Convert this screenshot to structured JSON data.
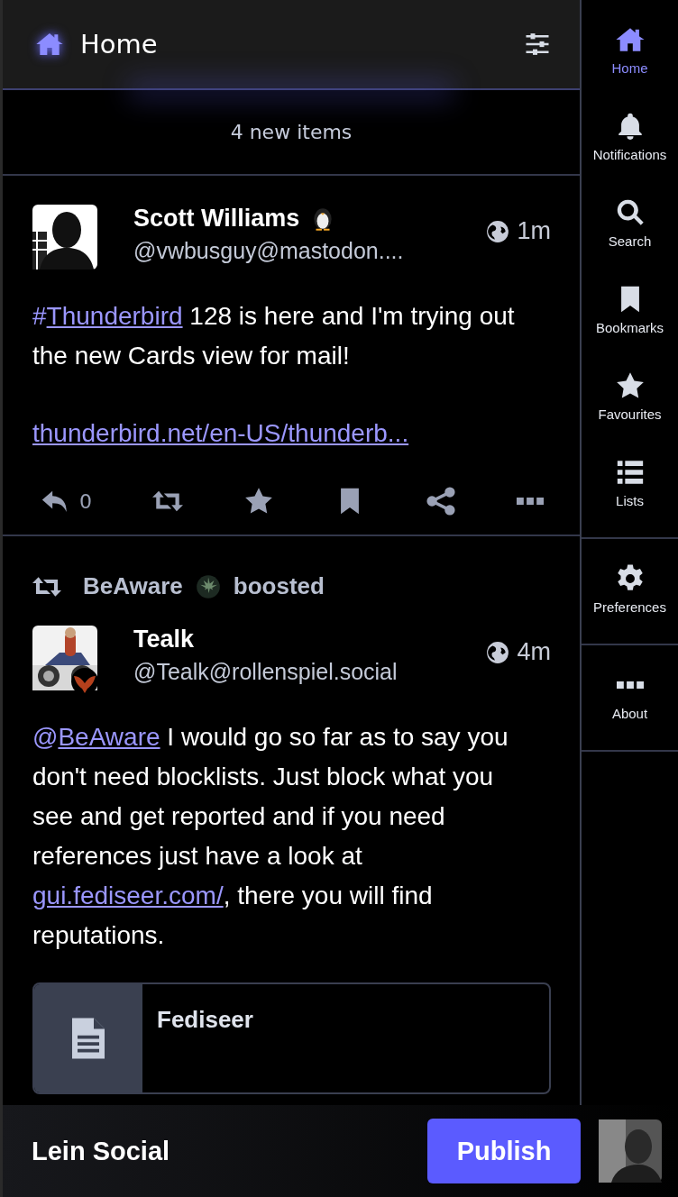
{
  "header": {
    "title": "Home"
  },
  "new_items": "4 new items",
  "posts": [
    {
      "kind": "status",
      "author": "Scott Williams",
      "handle": "@vwbusguy@mastodon....",
      "time": "1m",
      "avatar": {
        "kind": "picture"
      },
      "body": [
        [
          {
            "kind": "tag",
            "prefix": "#",
            "text": "Thunderbird"
          },
          {
            "kind": "text",
            "text": " 128 is here and I'm trying out the new Cards view for mail!"
          }
        ],
        [
          {
            "kind": "link",
            "text": "thunderbird.net/en-US/thunderb..."
          }
        ]
      ],
      "reply_count": "0"
    },
    {
      "kind": "boost",
      "booster": "BeAware",
      "boost_label": "boosted",
      "author": "Tealk",
      "handle": "@Tealk@rollenspiel.social",
      "time": "4m",
      "avatar": {
        "kind": "picture"
      },
      "body": [
        [
          {
            "kind": "tag",
            "prefix": "@",
            "text": "BeAware"
          },
          {
            "kind": "text",
            "text": " I would go so far as to say you don't need blocklists. Just block what you see and get reported and if you need references just have a look at "
          },
          {
            "kind": "link",
            "text": "gui.fediseer.com/"
          },
          {
            "kind": "text",
            "text": ", there you will find reputations."
          }
        ]
      ],
      "card": {
        "title": "Fediseer"
      }
    }
  ],
  "sidebar": {
    "groups": [
      [
        {
          "label": "Home",
          "selected": true
        },
        {
          "label": "Notifications",
          "selected": false
        },
        {
          "label": "Search",
          "selected": false
        },
        {
          "label": "Bookmarks",
          "selected": false
        },
        {
          "label": "Favourites",
          "selected": false
        },
        {
          "label": "Lists",
          "selected": false
        }
      ],
      [
        {
          "label": "Preferences",
          "selected": false
        }
      ],
      [
        {
          "label": "About",
          "selected": false
        }
      ]
    ]
  },
  "footer": {
    "brand": "Lein Social",
    "publish": "Publish"
  }
}
